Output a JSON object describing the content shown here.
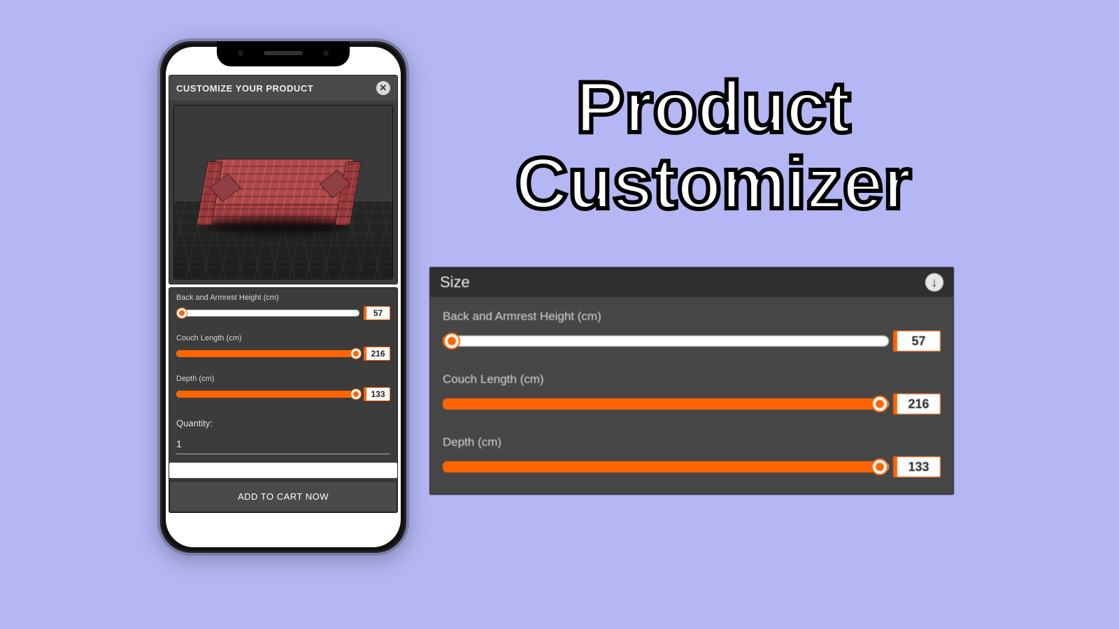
{
  "hero": {
    "line1": "Product",
    "line2": "Customizer"
  },
  "app": {
    "header_title": "CUSTOMIZE YOUR PRODUCT",
    "sliders": [
      {
        "label": "Back and Armrest Height (cm)",
        "value": "57",
        "fill_pct": 3
      },
      {
        "label": "Couch Length (cm)",
        "value": "216",
        "fill_pct": 98
      },
      {
        "label": "Depth (cm)",
        "value": "133",
        "fill_pct": 98
      }
    ],
    "quantity_label": "Quantity:",
    "quantity_value": "1",
    "add_to_cart": "ADD TO CART NOW"
  },
  "detail": {
    "title": "Size",
    "sliders": [
      {
        "label": "Back and Armrest Height (cm)",
        "value": "57",
        "fill_pct": 2
      },
      {
        "label": "Couch Length (cm)",
        "value": "216",
        "fill_pct": 98
      },
      {
        "label": "Depth (cm)",
        "value": "133",
        "fill_pct": 98
      }
    ]
  }
}
